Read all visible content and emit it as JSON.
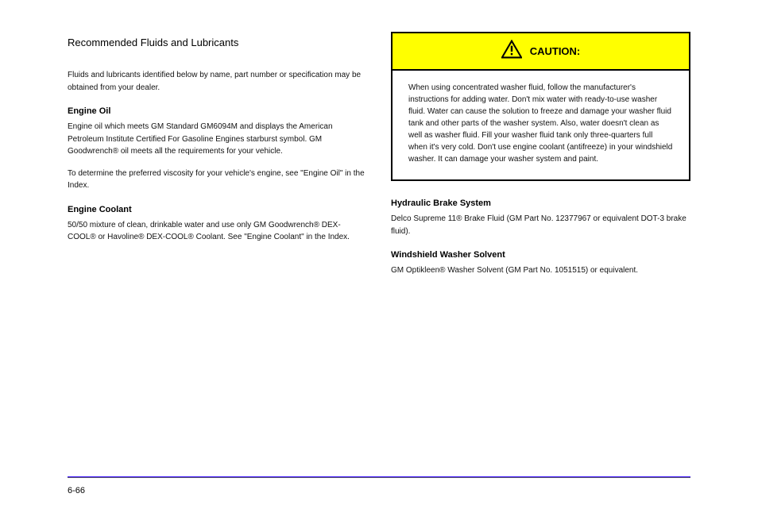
{
  "left": {
    "sectionTitle": "Recommended Fluids and Lubricants",
    "para1": "Fluids and lubricants identified below by name, part number or specification may be obtained from your dealer.",
    "subheading1": "Engine Oil",
    "para2": "Engine oil which meets GM Standard GM6094M and displays the American Petroleum Institute Certified For Gasoline Engines starburst symbol. GM Goodwrench® oil meets all the requirements for your vehicle.",
    "para3": "To determine the preferred viscosity for your vehicle's engine, see \"Engine Oil\" in the Index.",
    "subheading2": "Engine Coolant",
    "para4": "50/50 mixture of clean, drinkable water and use only GM Goodwrench® DEX-COOL® or Havoline® DEX-COOL® Coolant. See \"Engine Coolant\" in the Index."
  },
  "caution": {
    "title": "CAUTION:",
    "body": "When using concentrated washer fluid, follow the manufacturer's instructions for adding water. Don't mix water with ready-to-use washer fluid. Water can cause the solution to freeze and damage your washer fluid tank and other parts of the washer system. Also, water doesn't clean as well as washer fluid. Fill your washer fluid tank only three-quarters full when it's very cold. Don't use engine coolant (antifreeze) in your windshield washer. It can damage your washer system and paint."
  },
  "right": {
    "subheading1": "Hydraulic Brake System",
    "para1": "Delco Supreme 11® Brake Fluid (GM Part No. 12377967 or equivalent DOT-3 brake fluid).",
    "subheading2": "Windshield Washer Solvent",
    "para2": "GM Optikleen® Washer Solvent (GM Part No. 1051515) or equivalent."
  },
  "pageNum": "6-66"
}
